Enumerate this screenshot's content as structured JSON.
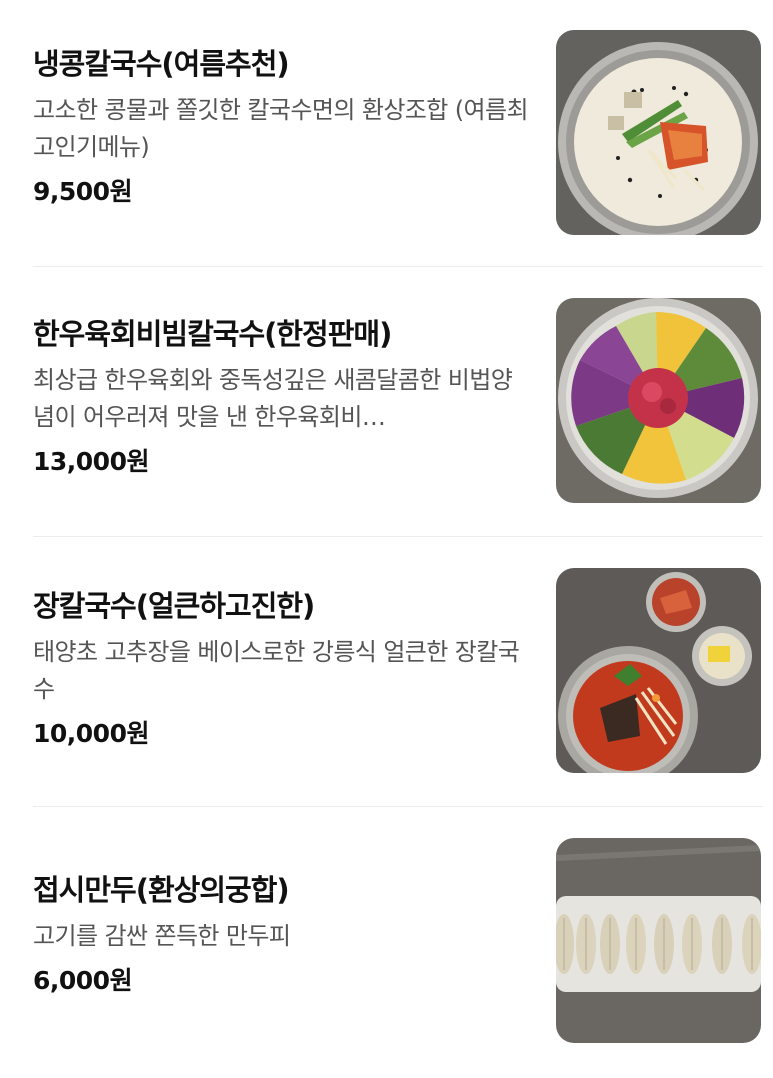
{
  "menu": {
    "items": [
      {
        "name": "냉콩칼국수(여름추천)",
        "description": "고소한 콩물과 쫄깃한 칼국수면의 환상조합 (여름최고인기메뉴)",
        "price": "9,500원",
        "image_icon": "soybean-noodle-photo"
      },
      {
        "name": "한우육회비빔칼국수(한정판매)",
        "description": "최상급 한우육회와 중독성깊은 새콤달콤한 비법양념이 어우러져 맛을 낸 한우육회비…",
        "price": "13,000원",
        "image_icon": "beef-tartare-bibim-noodle-photo"
      },
      {
        "name": "장칼국수(얼큰하고진한)",
        "description": "태양초 고추장을 베이스로한 강릉식 얼큰한 장칼국수",
        "price": "10,000원",
        "image_icon": "spicy-noodle-soup-photo"
      },
      {
        "name": "접시만두(환상의궁합)",
        "description": "고기를 감싼 쫀득한 만두피",
        "price": "6,000원",
        "image_icon": "dumplings-photo"
      }
    ]
  }
}
